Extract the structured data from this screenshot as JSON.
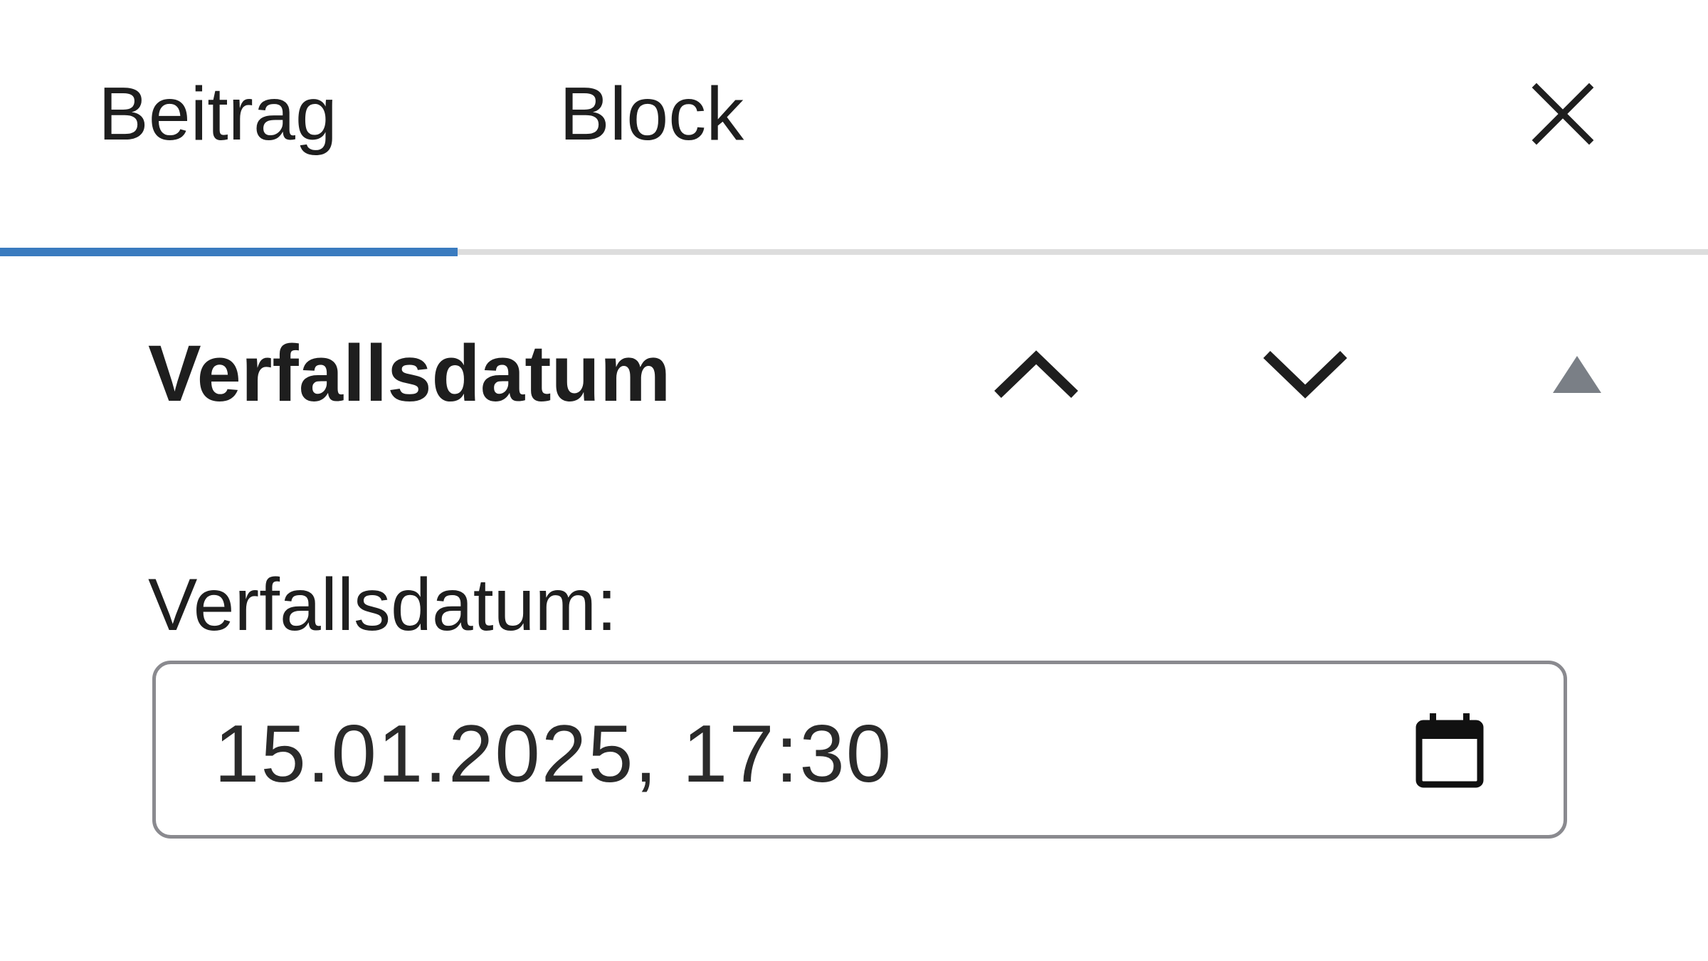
{
  "tabs": [
    {
      "label": "Beitrag",
      "active": true
    },
    {
      "label": "Block",
      "active": false
    }
  ],
  "icons": {
    "close": "close-icon",
    "move_up": "chevron-up-icon",
    "move_down": "chevron-down-icon",
    "collapse": "triangle-up-icon",
    "calendar": "calendar-icon"
  },
  "panel": {
    "title": "Verfallsdatum",
    "field_label": "Verfallsdatum:",
    "date_value": "15.01.2025, 17:30"
  },
  "colors": {
    "accent": "#3a7bbf",
    "text": "#1e1e1e",
    "muted_icon": "#7a7f86",
    "border": "#8a8a8f"
  }
}
